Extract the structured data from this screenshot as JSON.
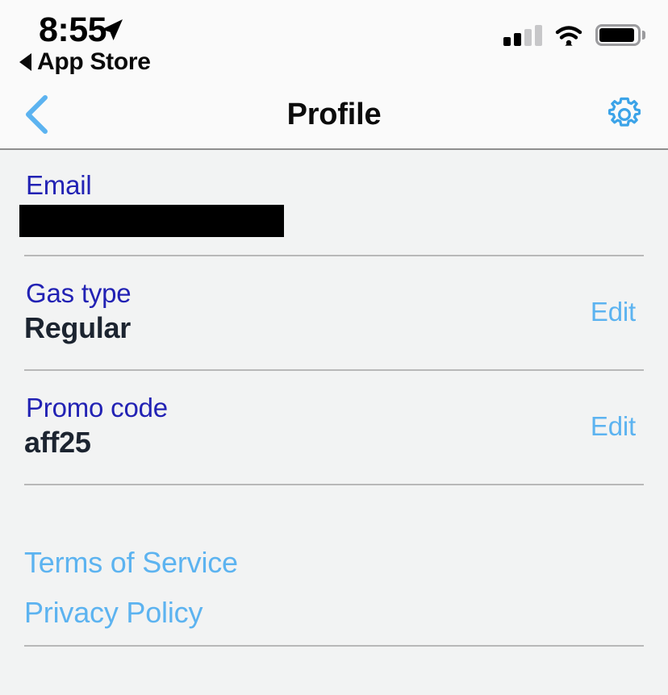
{
  "status_bar": {
    "time": "8:55",
    "location_icon": "location-arrow-icon",
    "back_to_app_label": "App Store",
    "back_to_app_icon": "triangle-left-icon",
    "signal_icon": "cellular-signal-icon",
    "signal_bars_filled": 2,
    "signal_bars_total": 4,
    "wifi_icon": "wifi-icon",
    "battery_icon": "battery-icon",
    "battery_level_percent": 93
  },
  "nav_bar": {
    "back_icon": "chevron-left-icon",
    "title": "Profile",
    "settings_icon": "gear-icon"
  },
  "rows": {
    "email": {
      "label": "Email",
      "value": "",
      "redacted": true
    },
    "gas_type": {
      "label": "Gas type",
      "value": "Regular",
      "edit_label": "Edit"
    },
    "promo_code": {
      "label": "Promo code",
      "value": "aff25",
      "edit_label": "Edit"
    }
  },
  "legal": {
    "terms_label": "Terms of Service",
    "privacy_label": "Privacy Policy"
  },
  "colors": {
    "label_blue": "#2222b4",
    "link_blue": "#5cb3f0",
    "value_dark": "#1c2430",
    "background": "#f2f3f3",
    "bar_background": "#fafafa",
    "divider": "#b8b8b8"
  }
}
